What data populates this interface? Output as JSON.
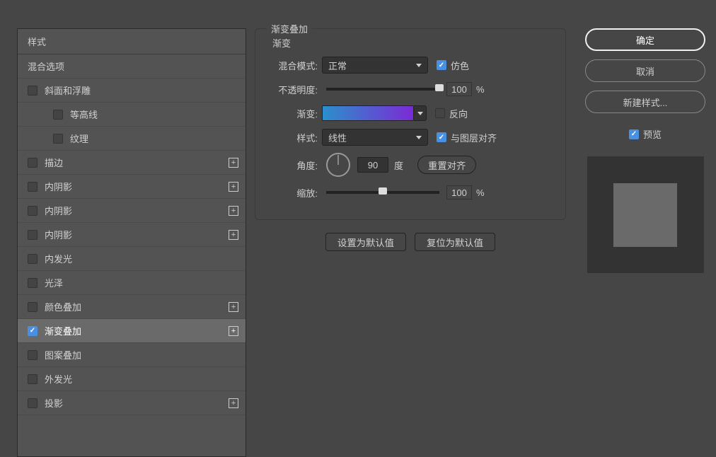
{
  "sidebar": {
    "header": "样式",
    "blending": "混合选项",
    "items": [
      {
        "label": "斜面和浮雕",
        "checked": false,
        "plus": false,
        "indent": false
      },
      {
        "label": "等高线",
        "checked": false,
        "plus": false,
        "indent": true
      },
      {
        "label": "纹理",
        "checked": false,
        "plus": false,
        "indent": true
      },
      {
        "label": "描边",
        "checked": false,
        "plus": true,
        "indent": false
      },
      {
        "label": "内阴影",
        "checked": false,
        "plus": true,
        "indent": false
      },
      {
        "label": "内阴影",
        "checked": false,
        "plus": true,
        "indent": false
      },
      {
        "label": "内阴影",
        "checked": false,
        "plus": true,
        "indent": false
      },
      {
        "label": "内发光",
        "checked": false,
        "plus": false,
        "indent": false
      },
      {
        "label": "光泽",
        "checked": false,
        "plus": false,
        "indent": false
      },
      {
        "label": "颜色叠加",
        "checked": false,
        "plus": true,
        "indent": false
      },
      {
        "label": "渐变叠加",
        "checked": true,
        "plus": true,
        "indent": false,
        "selected": true
      },
      {
        "label": "图案叠加",
        "checked": false,
        "plus": false,
        "indent": false
      },
      {
        "label": "外发光",
        "checked": false,
        "plus": false,
        "indent": false
      },
      {
        "label": "投影",
        "checked": false,
        "plus": true,
        "indent": false
      }
    ]
  },
  "panel": {
    "title": "渐变叠加",
    "subtitle": "渐变",
    "blend_label": "混合模式:",
    "blend_value": "正常",
    "dither": "仿色",
    "opacity_label": "不透明度:",
    "opacity_value": "100",
    "gradient_label": "渐变:",
    "reverse": "反向",
    "style_label": "样式:",
    "style_value": "线性",
    "align": "与图层对齐",
    "angle_label": "角度:",
    "angle_value": "90",
    "angle_unit": "度",
    "reset_align": "重置对齐",
    "scale_label": "缩放:",
    "scale_value": "100",
    "percent": "%",
    "set_default": "设置为默认值",
    "reset_default": "复位为默认值"
  },
  "buttons": {
    "ok": "确定",
    "cancel": "取消",
    "new_style": "新建样式...",
    "preview": "预览"
  }
}
